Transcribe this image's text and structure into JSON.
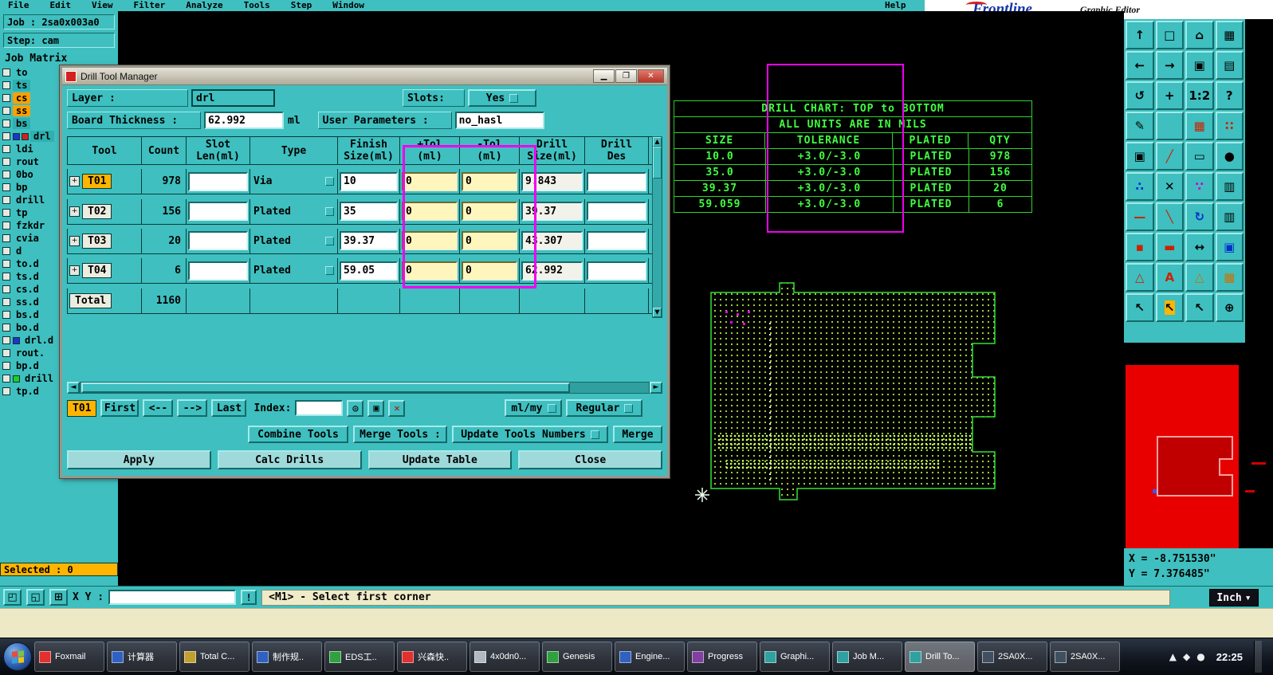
{
  "menu": {
    "items": [
      "File",
      "Edit",
      "View",
      "Filter",
      "Analyze",
      "Tools",
      "Step",
      "Window"
    ],
    "help": "Help"
  },
  "logo": {
    "brand": "Frontline",
    "caption": "Graphic Editor"
  },
  "left_panel": {
    "job_label": "Job : 2sa0x003a0",
    "step_label": "Step: cam",
    "matrix_title": "Job Matrix",
    "selected_label": "Selected : 0",
    "layers": [
      {
        "name": "to"
      },
      {
        "name": "ts",
        "bg": "#2FB0B0"
      },
      {
        "name": "cs",
        "bg": "#FFA000"
      },
      {
        "name": "ss",
        "bg": "#FFA000"
      },
      {
        "name": "bs",
        "bg": "#2FB0B0"
      },
      {
        "name": "drl",
        "bg": "#2FB0B0",
        "swatch": "#2233CC",
        "swatch2": "#CC2222"
      },
      {
        "name": "ldi"
      },
      {
        "name": "rout"
      },
      {
        "name": "0bo"
      },
      {
        "name": "bp"
      },
      {
        "name": "drill"
      },
      {
        "name": "tp"
      },
      {
        "name": "fzkdr"
      },
      {
        "name": "cvia"
      },
      {
        "name": "d"
      },
      {
        "name": "to.d"
      },
      {
        "name": "ts.d"
      },
      {
        "name": "cs.d"
      },
      {
        "name": "ss.d"
      },
      {
        "name": "bs.d"
      },
      {
        "name": "bo.d"
      },
      {
        "name": "drl.d",
        "swatch": "#2233CC"
      },
      {
        "name": "rout."
      },
      {
        "name": "bp.d"
      },
      {
        "name": "drill",
        "swatch": "#22CC22"
      },
      {
        "name": "tp.d"
      }
    ]
  },
  "dialog": {
    "title": "Drill Tool Manager",
    "layer_label": "Layer :",
    "layer_value": "drl",
    "slots_label": "Slots:",
    "slots_value": "Yes",
    "thickness_label": "Board Thickness :",
    "thickness_value": "62.992",
    "thickness_unit": "ml",
    "params_label": "User Parameters :",
    "params_value": "no_hasl",
    "table": {
      "headers": [
        "Tool",
        "Count",
        "Slot\nLen(ml)",
        "Type",
        "Finish\nSize(ml)",
        "+Tol\n(ml)",
        "-Tol\n(ml)",
        "Drill\nSize(ml)",
        "Drill\nDes"
      ],
      "rows": [
        {
          "tool": "T01",
          "tool_bg": "#FFB400",
          "count": "978",
          "type": "Via",
          "finish": "10",
          "ptol": "0",
          "ntol": "0",
          "drill": "9.843"
        },
        {
          "tool": "T02",
          "count": "156",
          "type": "Plated",
          "finish": "35",
          "ptol": "0",
          "ntol": "0",
          "drill": "39.37"
        },
        {
          "tool": "T03",
          "count": "20",
          "type": "Plated",
          "finish": "39.37",
          "ptol": "0",
          "ntol": "0",
          "drill": "43.307"
        },
        {
          "tool": "T04",
          "count": "6",
          "type": "Plated",
          "finish": "59.05",
          "ptol": "0",
          "ntol": "0",
          "drill": "62.992"
        }
      ],
      "total_label": "Total",
      "total_count": "1160"
    },
    "nav": {
      "current": "T01",
      "first": "First",
      "prev": "<--",
      "next": "-->",
      "last": "Last",
      "index_label": "Index:",
      "units": "ml/my",
      "mode": "Regular"
    },
    "merge": {
      "combine": "Combine Tools",
      "merge_tools": "Merge Tools :",
      "update_numbers": "Update Tools Numbers",
      "merge": "Merge"
    },
    "actions": [
      {
        "label": "Apply"
      },
      {
        "label": "Calc Drills"
      },
      {
        "label": "Update Table"
      },
      {
        "label": "Close"
      }
    ]
  },
  "editor": {
    "chart": {
      "title": "DRILL CHART: TOP to BOTTOM",
      "subtitle": "ALL UNITS ARE IN MILS",
      "headers": [
        "SIZE",
        "TOLERANCE",
        "PLATED",
        "QTY"
      ],
      "rows": [
        [
          "10.0",
          "+3.0/-3.0",
          "PLATED",
          "978"
        ],
        [
          "35.0",
          "+3.0/-3.0",
          "PLATED",
          "156"
        ],
        [
          "39.37",
          "+3.0/-3.0",
          "PLATED",
          "20"
        ],
        [
          "59.059",
          "+3.0/-3.0",
          "PLATED",
          "6"
        ]
      ]
    }
  },
  "toolbar": {
    "icons": [
      {
        "name": "move-up-icon",
        "glyph": "↑"
      },
      {
        "name": "screen-icon",
        "glyph": "□"
      },
      {
        "name": "home-icon",
        "glyph": "⌂"
      },
      {
        "name": "grid-icon",
        "glyph": "▦"
      },
      {
        "name": "move-left-icon",
        "glyph": "←"
      },
      {
        "name": "move-right-icon",
        "glyph": "→"
      },
      {
        "name": "windows-icon",
        "glyph": "▣"
      },
      {
        "name": "layers-icon",
        "glyph": "▤"
      },
      {
        "name": "rotate-icon",
        "glyph": "↺"
      },
      {
        "name": "center-icon",
        "glyph": "+"
      },
      {
        "name": "scale-icon",
        "glyph": "1:2"
      },
      {
        "name": "help-icon",
        "glyph": "?"
      },
      {
        "name": "sketch-icon",
        "glyph": "✎"
      },
      {
        "name": "blank-icon",
        "glyph": ""
      },
      {
        "name": "pad-grid-icon",
        "glyph": "▦",
        "fg": "#CC2200"
      },
      {
        "name": "dot-matrix-icon",
        "glyph": "∷",
        "fg": "#CC2200"
      },
      {
        "name": "fill-icon",
        "glyph": "▣"
      },
      {
        "name": "line-icon",
        "glyph": "╱",
        "fg": "#CC2200"
      },
      {
        "name": "ruler-icon",
        "glyph": "▭"
      },
      {
        "name": "circle-icon",
        "glyph": "●"
      },
      {
        "name": "net-icon",
        "glyph": "∴",
        "fg": "#0033CC"
      },
      {
        "name": "delete-icon",
        "glyph": "✕"
      },
      {
        "name": "scatter-icon",
        "glyph": "∵",
        "fg": "#CC00CC"
      },
      {
        "name": "table-icon",
        "glyph": "▥"
      },
      {
        "name": "measure-line-icon",
        "glyph": "—",
        "fg": "#CC2200"
      },
      {
        "name": "slope-icon",
        "glyph": "╲",
        "fg": "#CC2200"
      },
      {
        "name": "refresh-icon",
        "glyph": "↻",
        "fg": "#0033CC"
      },
      {
        "name": "columns-icon",
        "glyph": "▥"
      },
      {
        "name": "point-icon",
        "glyph": "▪",
        "fg": "#CC2200"
      },
      {
        "name": "dash-icon",
        "glyph": "▬",
        "fg": "#CC2200"
      },
      {
        "name": "distance-icon",
        "glyph": "↔"
      },
      {
        "name": "chip-icon",
        "glyph": "▣",
        "fg": "#0033CC"
      },
      {
        "name": "warning-icon",
        "glyph": "△",
        "fg": "#CC2200"
      },
      {
        "name": "text-icon",
        "glyph": "A",
        "fg": "#CC2200"
      },
      {
        "name": "outline-triangle-icon",
        "glyph": "△",
        "fg": "#D07000"
      },
      {
        "name": "mesh-icon",
        "glyph": "▦",
        "fg": "#D07000"
      },
      {
        "name": "cursor-icon",
        "glyph": "↖"
      },
      {
        "name": "cursor-select-icon",
        "glyph": "↖",
        "bg": "#FFB400"
      },
      {
        "name": "cursor-alt-icon",
        "glyph": "↖"
      },
      {
        "name": "pick-icon",
        "glyph": "⊕"
      }
    ]
  },
  "right_panel": {
    "coords_x": "X = -8.751530\"",
    "coords_y": "Y = 7.376485\""
  },
  "status_bar": {
    "xy_label": "X Y :",
    "alert": "!",
    "message": "<M1> - Select first corner",
    "units_button": "Inch"
  },
  "taskbar": {
    "clock": "22:25",
    "buttons": [
      {
        "label": "Foxmail",
        "color": "#E03030"
      },
      {
        "label": "计算器",
        "color": "#3060C0"
      },
      {
        "label": "Total C...",
        "color": "#C0A030"
      },
      {
        "label": "制作规..",
        "color": "#3060C0"
      },
      {
        "label": "EDS工..",
        "color": "#30A040"
      },
      {
        "label": "兴森快..",
        "color": "#E03030"
      },
      {
        "label": "4x0dn0...",
        "color": "#B0B8C0"
      },
      {
        "label": "Genesis",
        "color": "#30A040"
      },
      {
        "label": "Engine...",
        "color": "#3060C0"
      },
      {
        "label": "Progress",
        "color": "#8040A0"
      },
      {
        "label": "Graphi...",
        "color": "#30A0A0"
      },
      {
        "label": "Job M...",
        "color": "#30A0A0"
      },
      {
        "label": "Drill To...",
        "color": "#30A0A0",
        "btn_bg": "rgba(255,255,255,0.35)"
      },
      {
        "label": "2SA0X...",
        "color": "#405060"
      },
      {
        "label": "2SA0X...",
        "color": "#405060"
      }
    ]
  }
}
